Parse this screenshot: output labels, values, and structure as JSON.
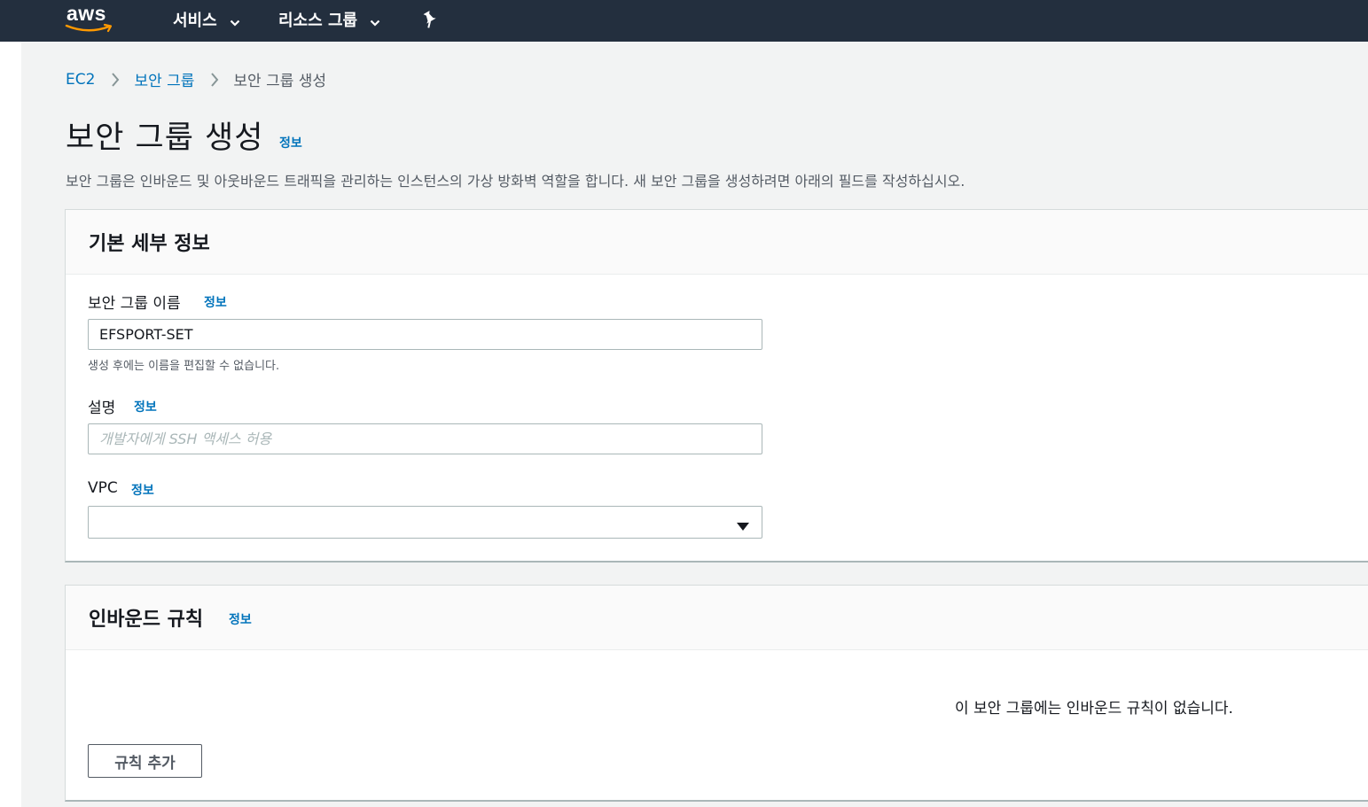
{
  "topbar": {
    "logo_text": "aws",
    "services_label": "서비스",
    "resource_groups_label": "리소스 그룹",
    "pin_icon": "pin-icon",
    "chevron_icon": "chevron-down-icon"
  },
  "breadcrumb": {
    "items": [
      "EC2",
      "보안 그룹",
      "보안 그룹 생성"
    ]
  },
  "page": {
    "title": "보안 그룹 생성",
    "info": "정보",
    "description": "보안 그룹은 인바운드 및 아웃바운드 트래픽을 관리하는 인스턴스의 가상 방화벽 역할을 합니다. 새 보안 그룹을 생성하려면 아래의 필드를 작성하십시오."
  },
  "basic_details": {
    "title": "기본 세부 정보",
    "name_label": "보안 그룹 이름",
    "name_info": "정보",
    "name_value": "EFSPORT-SET",
    "name_hint": "생성 후에는 이름을 편집할 수 없습니다.",
    "description_label": "설명",
    "description_info": "정보",
    "description_value": "",
    "description_placeholder": "개발자에게 SSH 액세스 허용",
    "vpc_label": "VPC",
    "vpc_info": "정보",
    "vpc_value": ""
  },
  "inbound_rules": {
    "title": "인바운드 규칙",
    "info": "정보",
    "empty_message": "이 보안 그룹에는 인바운드 규칙이 없습니다.",
    "add_rule_label": "규칙 추가"
  },
  "colors": {
    "topbar_bg": "#232f3e",
    "link": "#0073bb",
    "page_bg": "#f2f3f3",
    "logo_accent": "#ff9900"
  }
}
